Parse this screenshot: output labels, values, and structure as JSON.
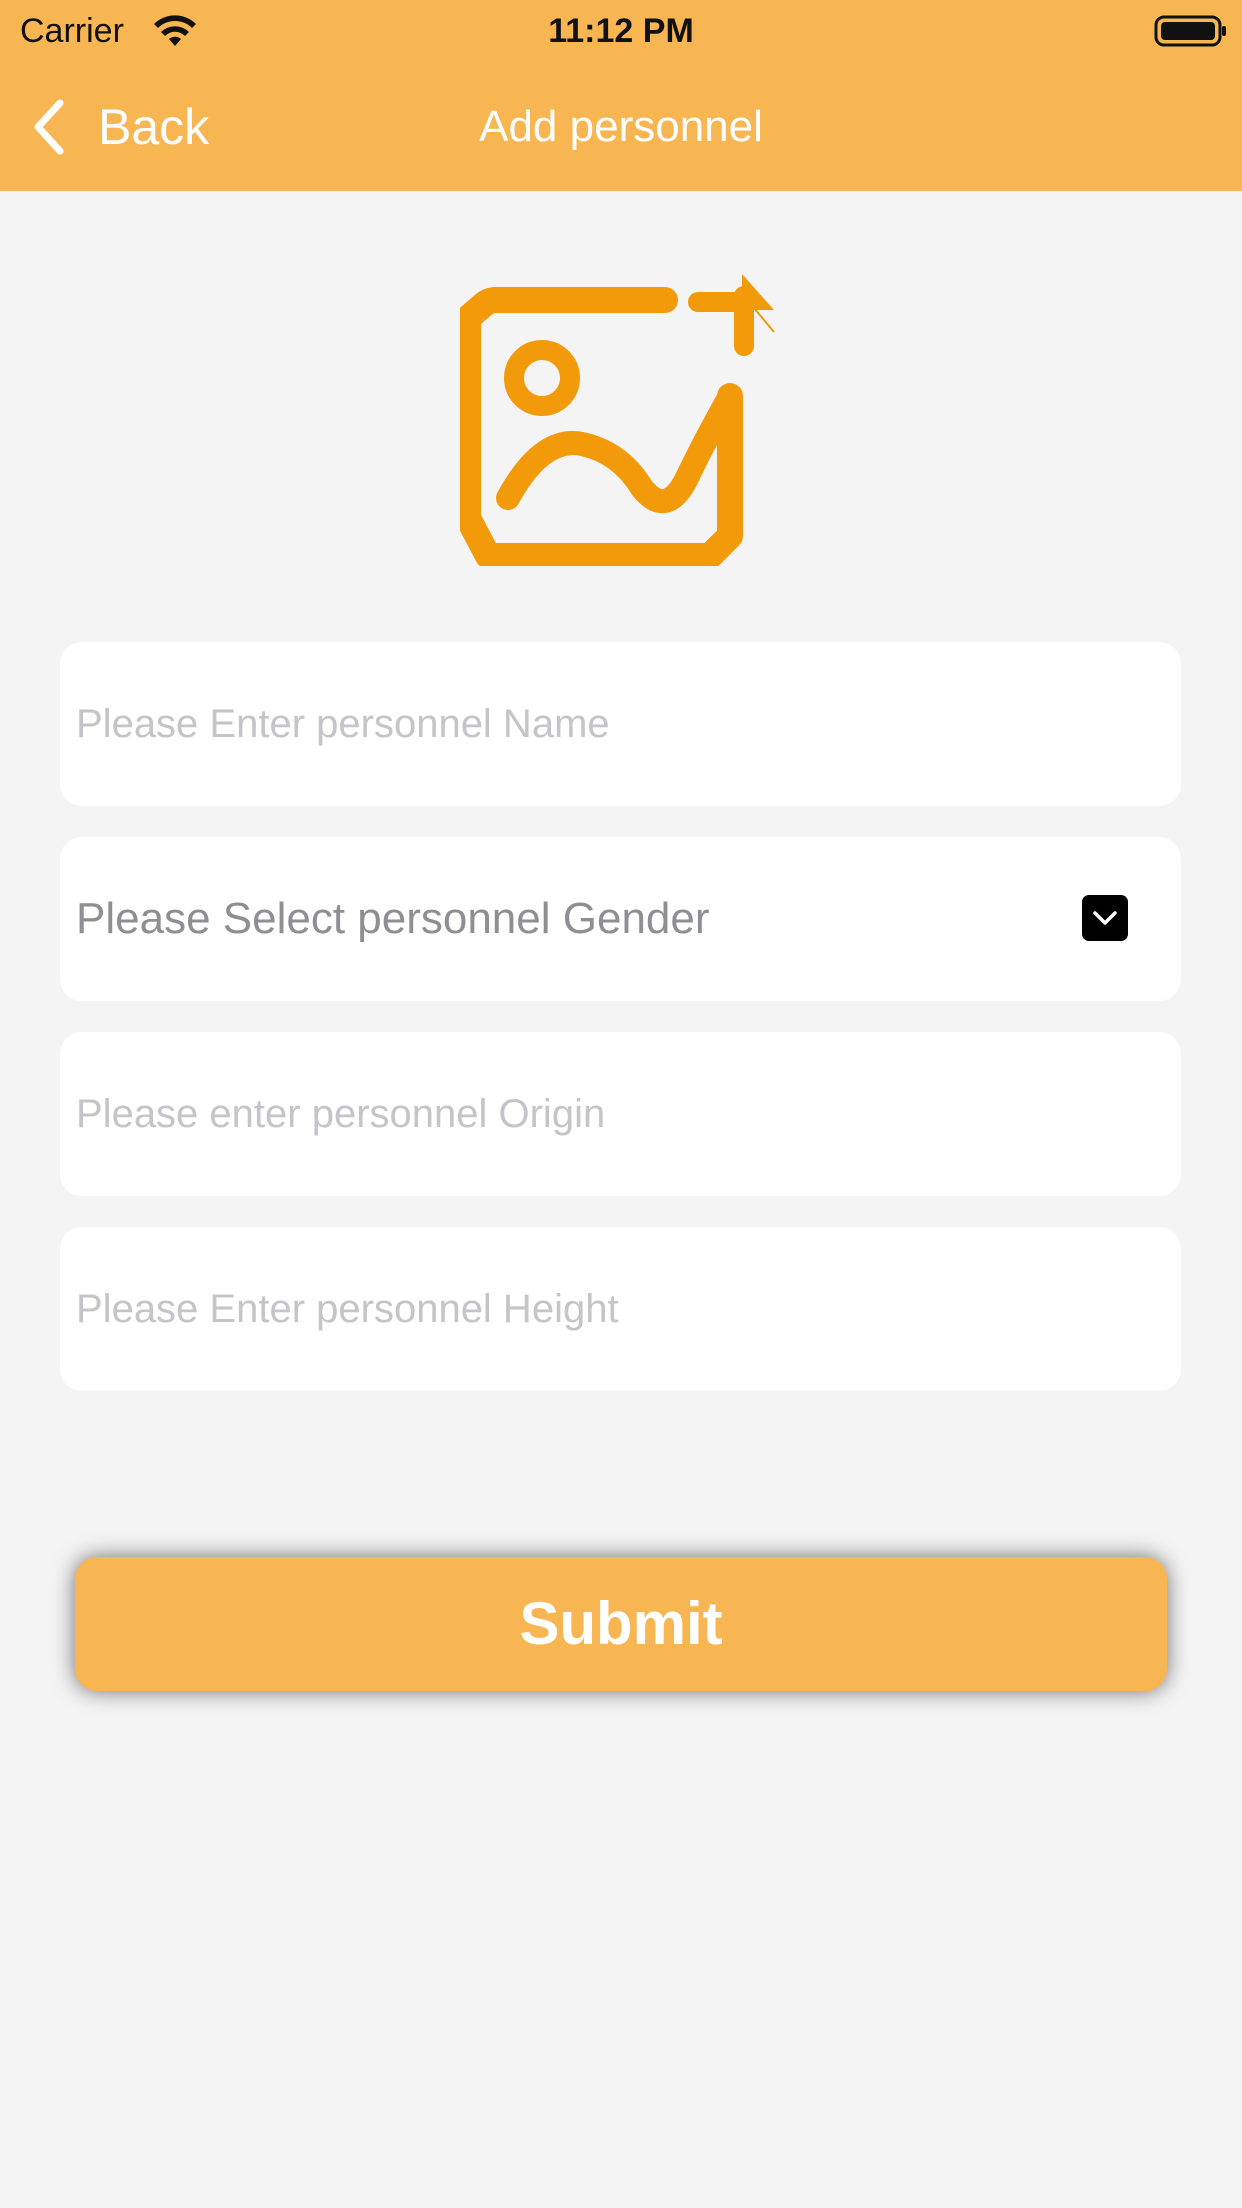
{
  "status_bar": {
    "carrier": "Carrier",
    "time": "11:12 PM",
    "wifi_icon": "wifi-icon",
    "battery_icon": "battery-full-icon"
  },
  "nav": {
    "back_label": "Back",
    "back_icon": "chevron-left-icon",
    "title": "Add personnel"
  },
  "avatar": {
    "icon": "add-image-icon"
  },
  "form": {
    "name_placeholder": "Please Enter personnel Name",
    "gender_label": "Please Select personnel Gender",
    "gender_icon": "chevron-down-icon",
    "origin_placeholder": "Please enter personnel Origin",
    "height_placeholder": "Please Enter personnel Height",
    "submit_label": "Submit"
  },
  "colors": {
    "accent": "#f8b653",
    "icon_orange": "#f39a0b",
    "background": "#f4f4f4",
    "field_background": "#ffffff",
    "placeholder": "#c4c4c9"
  }
}
